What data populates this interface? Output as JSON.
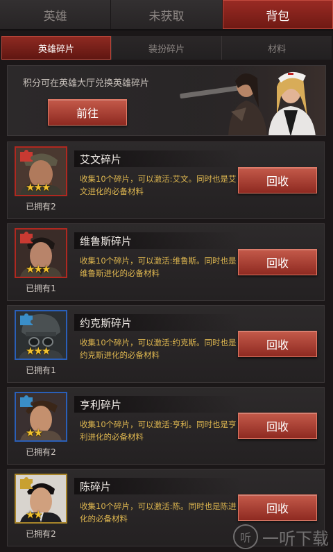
{
  "tabs": [
    {
      "label": "英雄",
      "active": false
    },
    {
      "label": "未获取",
      "active": false
    },
    {
      "label": "背包",
      "active": true
    }
  ],
  "subtabs": [
    {
      "label": "英雄碎片",
      "active": true
    },
    {
      "label": "装扮碎片",
      "active": false
    },
    {
      "label": "材料",
      "active": false
    }
  ],
  "banner": {
    "text": "积分可在英雄大厅兑换英雄碎片",
    "button_label": "前往"
  },
  "cards": [
    {
      "name": "艾文碎片",
      "desc": "收集10个碎片，可以激活:艾文。同时也是艾文进化的必备材料",
      "owned": "已拥有2",
      "stars": "★★★",
      "star_count": 3,
      "frame": "red",
      "button_label": "回收"
    },
    {
      "name": "维鲁斯碎片",
      "desc": "收集10个碎片，可以激活:维鲁斯。同时也是维鲁斯进化的必备材料",
      "owned": "已拥有1",
      "stars": "★★★",
      "star_count": 3,
      "frame": "red",
      "button_label": "回收"
    },
    {
      "name": "约克斯碎片",
      "desc": "收集10个碎片，可以激活:约克斯。同时也是约克斯进化的必备材料",
      "owned": "已拥有1",
      "stars": "★★★",
      "star_count": 3,
      "frame": "blue",
      "button_label": "回收"
    },
    {
      "name": "亨利碎片",
      "desc": "收集10个碎片，可以激活:亨利。同时也是亨利进化的必备材料",
      "owned": "已拥有2",
      "stars": "★★",
      "star_count": 2,
      "frame": "blue",
      "button_label": "回收"
    },
    {
      "name": "陈碎片",
      "desc": "收集10个碎片，可以激活:陈。同时也是陈进化的必备材料",
      "owned": "已拥有2",
      "stars": "★★",
      "star_count": 2,
      "frame": "gold",
      "button_label": "回收"
    }
  ],
  "watermark": {
    "icon": "听",
    "text": "一听下载"
  },
  "colors": {
    "accent": "#8f2a22",
    "button": "#b5483b",
    "desc_text": "#e0b850",
    "frame_red": "#b02820",
    "frame_blue": "#2a5fb8",
    "frame_gold": "#a8852a"
  }
}
